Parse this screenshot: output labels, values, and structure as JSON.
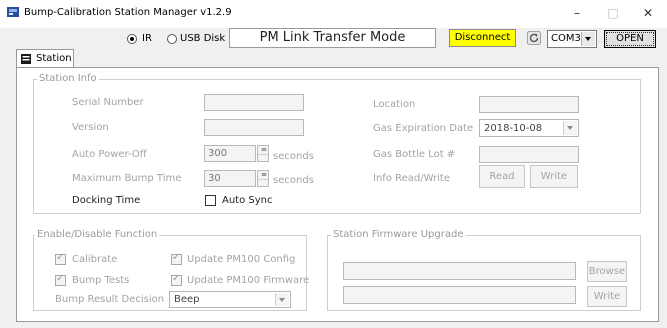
{
  "window": {
    "title": "Bump-Calibration Station Manager v1.2.9",
    "minimize_glyph": "–",
    "maximize_glyph": "□",
    "close_glyph": "✕"
  },
  "toolbar": {
    "radio_ir_label": "IR",
    "radio_ir_selected": true,
    "radio_usb_label": "USB Disk",
    "mode_text": "PM Link Transfer Mode",
    "disconnect_label": "Disconnect",
    "disconnect_color": "#ffff00",
    "refresh_icon": "refresh-icon",
    "com_port": "COM3",
    "open_label": "OPEN"
  },
  "tabs": [
    {
      "label": "Station",
      "icon": "station-icon",
      "active": true
    }
  ],
  "station_info": {
    "legend": "Station Info",
    "serial_number_label": "Serial Number",
    "serial_number_value": "",
    "version_label": "Version",
    "version_value": "",
    "auto_power_off_label": "Auto Power-Off",
    "auto_power_off_value": "300",
    "auto_power_off_unit": "seconds",
    "max_bump_time_label": "Maximum Bump Time",
    "max_bump_time_value": "30",
    "max_bump_time_unit": "seconds",
    "docking_time_label": "Docking Time",
    "auto_sync_label": "Auto Sync",
    "auto_sync_checked": false,
    "location_label": "Location",
    "location_value": "",
    "gas_expiration_label": "Gas Expiration Date",
    "gas_expiration_value": "2018-10-08",
    "gas_bottle_lot_label": "Gas Bottle Lot #",
    "gas_bottle_lot_value": "",
    "info_rw_label": "Info Read/Write",
    "read_label": "Read",
    "write_label": "Write"
  },
  "enable_disable": {
    "legend": "Enable/Disable Function",
    "calibrate_label": "Calibrate",
    "calibrate_checked": true,
    "bump_tests_label": "Bump Tests",
    "bump_tests_checked": true,
    "update_config_label": "Update PM100 Config",
    "update_config_checked": true,
    "update_firmware_label": "Update PM100 Firmware",
    "update_firmware_checked": true,
    "bump_result_label": "Bump Result Decision",
    "bump_result_value": "Beep"
  },
  "firmware_upgrade": {
    "legend": "Station Firmware Upgrade",
    "path_value": "",
    "browse_label": "Browse",
    "progress_value": "",
    "write_label": "Write"
  }
}
